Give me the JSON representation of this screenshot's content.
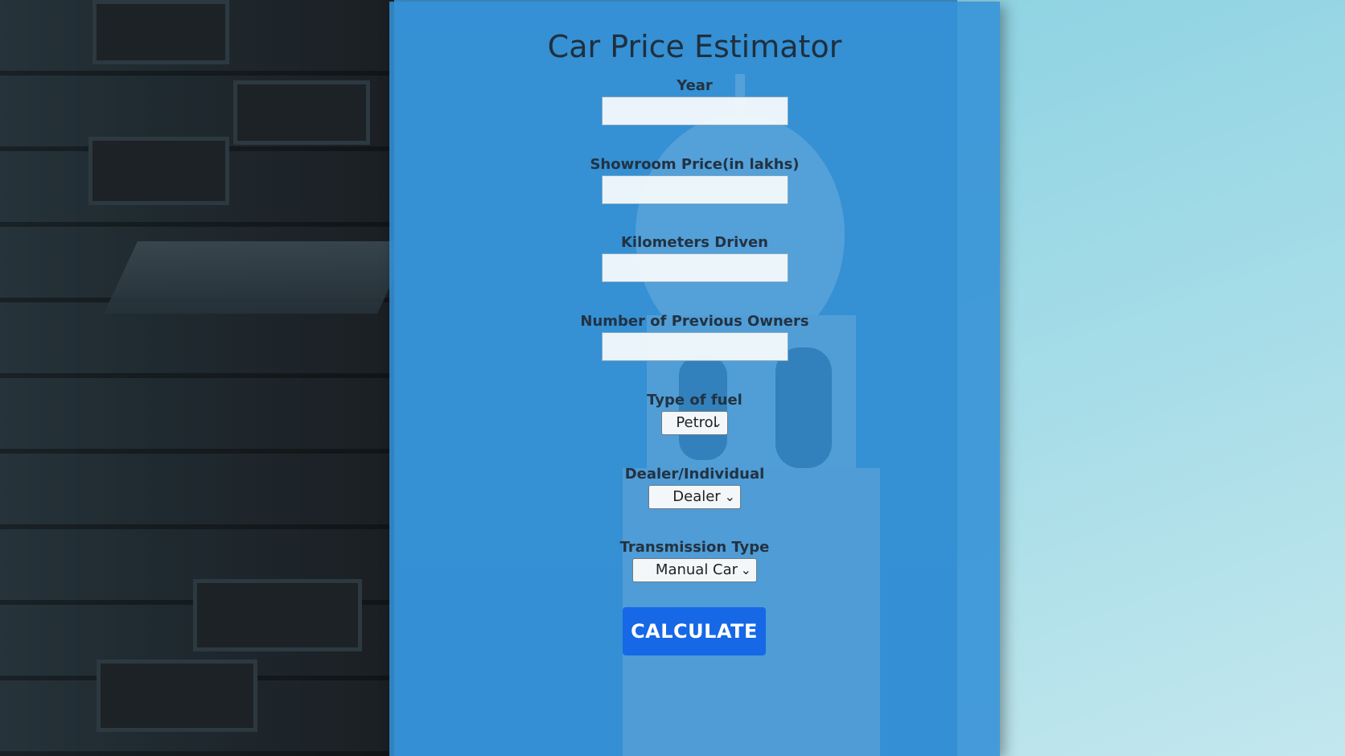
{
  "header": {
    "title": "Car Price Estimator"
  },
  "form": {
    "year": {
      "label": "Year",
      "value": ""
    },
    "showroom_price": {
      "label": "Showroom Price(in lakhs)",
      "value": ""
    },
    "kms_driven": {
      "label": "Kilometers Driven",
      "value": ""
    },
    "owners": {
      "label": "Number of Previous Owners",
      "value": ""
    },
    "fuel": {
      "label": "Type of fuel",
      "selected": "Petrol"
    },
    "seller": {
      "label": "Dealer/Individual",
      "selected": "Dealer"
    },
    "transmission": {
      "label": "Transmission Type",
      "selected": "Manual Car"
    },
    "submit_label": "CALCULATE"
  },
  "icons": {
    "select_chevron": "chevron-down-icon"
  },
  "colors": {
    "panel": "#3491d6",
    "button": "#1668e6",
    "text": "#233241"
  }
}
